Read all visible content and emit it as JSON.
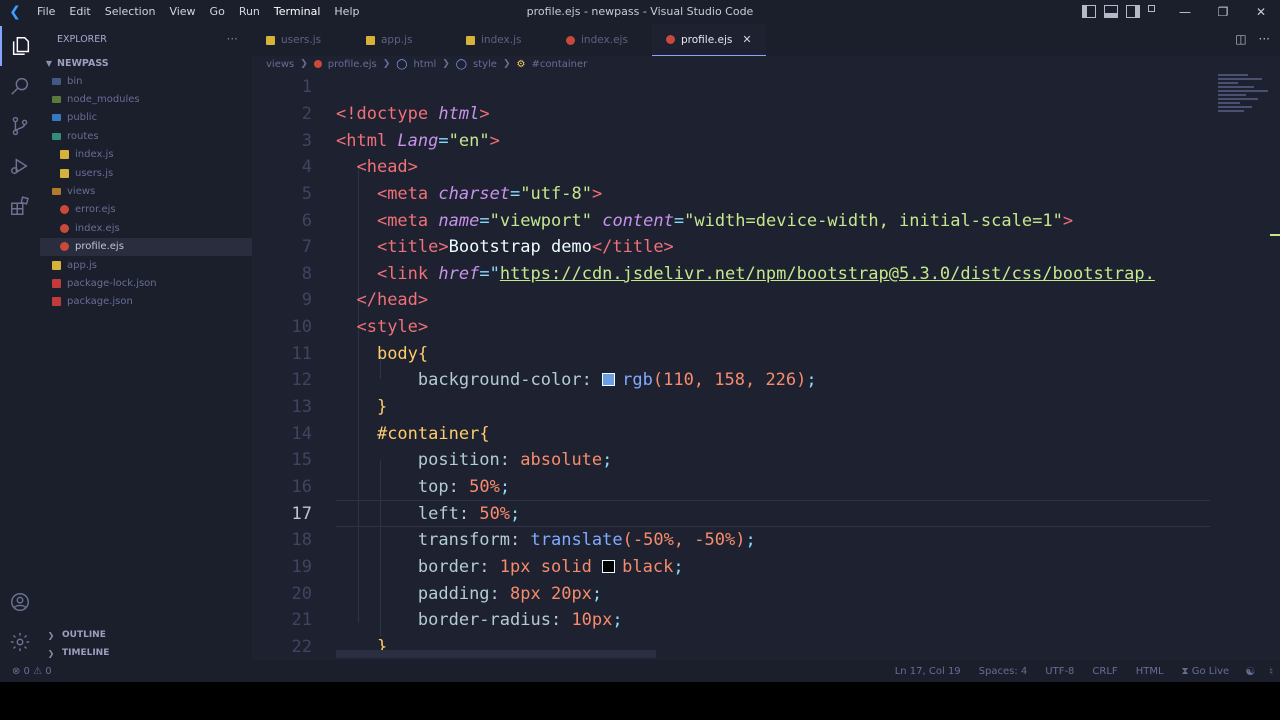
{
  "window": {
    "title": "profile.ejs - newpass - Visual Studio Code",
    "menu": [
      "File",
      "Edit",
      "Selection",
      "View",
      "Go",
      "Run",
      "Terminal",
      "Help"
    ],
    "active_menu": "Terminal"
  },
  "sidebar": {
    "header": "EXPLORER",
    "more": "···",
    "root": "NEWPASS",
    "items": [
      {
        "label": "bin",
        "type": "folder",
        "depth": 0
      },
      {
        "label": "node_modules",
        "type": "folder-node",
        "depth": 0
      },
      {
        "label": "public",
        "type": "folder-pub",
        "depth": 0
      },
      {
        "label": "routes",
        "type": "folder-routes",
        "depth": 0,
        "open": true
      },
      {
        "label": "index.js",
        "type": "js",
        "depth": 1
      },
      {
        "label": "users.js",
        "type": "js",
        "depth": 1
      },
      {
        "label": "views",
        "type": "folder-views",
        "depth": 0,
        "open": true
      },
      {
        "label": "error.ejs",
        "type": "ejs",
        "depth": 1
      },
      {
        "label": "index.ejs",
        "type": "ejs",
        "depth": 1
      },
      {
        "label": "profile.ejs",
        "type": "ejs",
        "depth": 1,
        "selected": true
      },
      {
        "label": "app.js",
        "type": "js",
        "depth": 0
      },
      {
        "label": "package-lock.json",
        "type": "json",
        "depth": 0
      },
      {
        "label": "package.json",
        "type": "json",
        "depth": 0
      }
    ],
    "outline": "OUTLINE",
    "timeline": "TIMELINE"
  },
  "tabs": [
    {
      "label": "users.js",
      "type": "js"
    },
    {
      "label": "app.js",
      "type": "js"
    },
    {
      "label": "index.js",
      "type": "js"
    },
    {
      "label": "index.ejs",
      "type": "ejs"
    },
    {
      "label": "profile.ejs",
      "type": "ejs",
      "active": true
    }
  ],
  "breadcrumb": [
    "views",
    "profile.ejs",
    "html",
    "style",
    "#container"
  ],
  "editor": {
    "current_line": 17,
    "line_numbers": [
      "1",
      "2",
      "3",
      "4",
      "5",
      "6",
      "7",
      "8",
      "9",
      "10",
      "11",
      "12",
      "13",
      "14",
      "15",
      "16",
      "17",
      "18",
      "19",
      "20",
      "21",
      "22"
    ],
    "tokens": {
      "l2_doctype": "<!doctype",
      "l2_html": "html",
      "l2_close": ">",
      "l3_open": "<html",
      "l3_attr": "Lang",
      "l3_eq": "=",
      "l3_val": "\"en\"",
      "l3_close": ">",
      "l4": "<head>",
      "l5_open": "<meta",
      "l5_attr": "charset",
      "l5_eq": "=",
      "l5_val": "\"utf-8\"",
      "l5_close": ">",
      "l6_open": "<meta",
      "l6_attr1": "name",
      "l6_eq1": "=",
      "l6_val1": "\"viewport\"",
      "l6_attr2": "content",
      "l6_eq2": "=",
      "l6_val2": "\"width=device-width, initial-scale=1\"",
      "l6_close": ">",
      "l7_open": "<title>",
      "l7_text": "Bootstrap demo",
      "l7_close": "</title>",
      "l8_open": "<link",
      "l8_attr": "href",
      "l8_eq": "=\"",
      "l8_url": "https://cdn.jsdelivr.net/npm/bootstrap@5.3.0/dist/css/bootstrap.",
      "l9": "</head>",
      "l10": "<style>",
      "l11_sel": "body",
      "l11_brace": "{",
      "l12_prop": "background-color:",
      "l12_fn": "rgb",
      "l12_args": "(110, 158, 226)",
      "l12_semi": ";",
      "l13": "}",
      "l14_sel": "#container",
      "l14_brace": "{",
      "l15_prop": "position:",
      "l15_val": "absolute",
      "l15_semi": ";",
      "l16_prop": "top:",
      "l16_val": "50%",
      "l16_semi": ";",
      "l17_prop": "left:",
      "l17_val": "50%",
      "l17_semi": ";",
      "l18_prop": "transform:",
      "l18_fn": "translate",
      "l18_args": "(-50%, -50%)",
      "l18_semi": ";",
      "l19_prop": "border:",
      "l19_val": "1px solid",
      "l19_color": "black",
      "l19_semi": ";",
      "l20_prop": "padding:",
      "l20_val": "8px 20px",
      "l20_semi": ";",
      "l21_prop": "border-radius:",
      "l21_val": "10px",
      "l21_semi": ";",
      "l22": "}"
    },
    "swatch_bg": "#6e9ee2",
    "swatch_black": "#000000"
  },
  "statusbar": {
    "errors": "⊗ 0 ⚠ 0",
    "position": "Ln 17, Col 19",
    "spaces": "Spaces: 4",
    "encoding": "UTF-8",
    "eol": "CRLF",
    "language": "HTML",
    "golive": "Go Live"
  },
  "colors": {
    "editor_bg": "#1e2130",
    "sidebar_bg": "#1b1e2b",
    "accent": "#84a6ff"
  }
}
